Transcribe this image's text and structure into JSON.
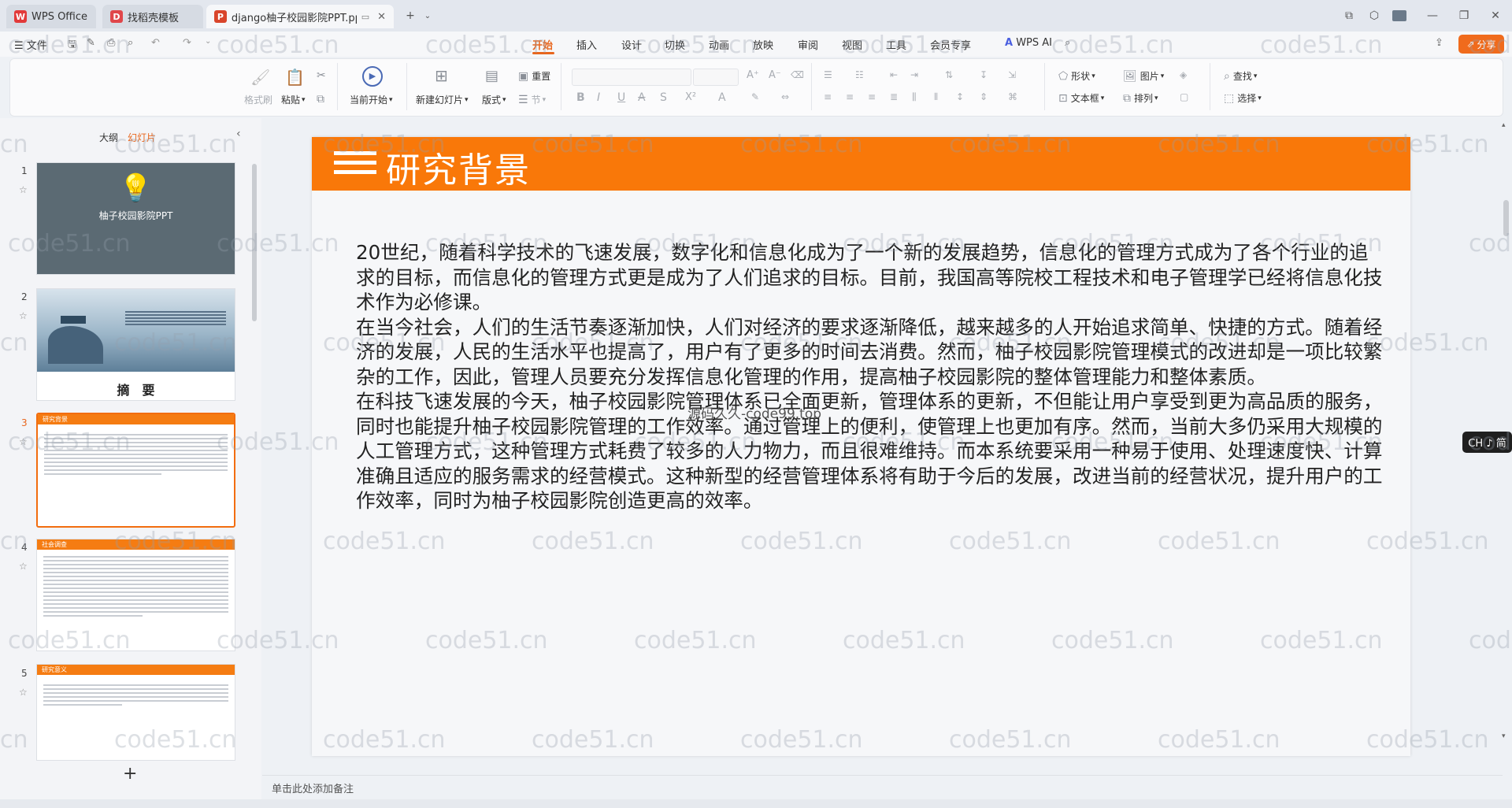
{
  "tabs": [
    {
      "label": "WPS Office",
      "icon": "wps-logo-icon"
    },
    {
      "label": "找稻壳模板",
      "icon": "docer-icon"
    },
    {
      "label": "django柚子校园影院PPT.pp",
      "icon": "ppt-file-icon"
    }
  ],
  "menu": {
    "file": "文件",
    "items": [
      "开始",
      "插入",
      "设计",
      "切换",
      "动画",
      "放映",
      "审阅",
      "视图",
      "工具",
      "会员专享"
    ],
    "active": "开始",
    "wps_ai": "WPS AI",
    "share": "分享"
  },
  "ribbon": {
    "format_painter": "格式刷",
    "paste": "粘贴",
    "play_from_start": "当前开始",
    "new_slide": "新建幻灯片",
    "layout": "版式",
    "reset": "重置",
    "section": "节",
    "shape": "形状",
    "picture": "图片",
    "textbox": "文本框",
    "arrange": "排列",
    "find": "查找",
    "select": "选择"
  },
  "leftpanel": {
    "outline_tab": "大纲",
    "slides_tab": "幻灯片",
    "thumbs": [
      {
        "num": "1",
        "title": "柚子校园影院PPT"
      },
      {
        "num": "2",
        "title": "摘　要"
      },
      {
        "num": "3",
        "title": "研究背景"
      },
      {
        "num": "4",
        "title": "社会调查"
      },
      {
        "num": "5",
        "title": "研究意义"
      }
    ],
    "add": "+"
  },
  "slide": {
    "title": "研究背景",
    "paragraphs": [
      "20世纪，随着科学技术的飞速发展，数字化和信息化成为了一个新的发展趋势，信息化的管理方式成为了各个行业的追求的目标，而信息化的管理方式更是成为了人们追求的目标。目前，我国高等院校工程技术和电子管理学已经将信息化技术作为必修课。",
      "在当今社会，人们的生活节奏逐渐加快，人们对经济的要求逐渐降低，越来越多的人开始追求简单、快捷的方式。随着经济的发展，人民的生活水平也提高了，用户有了更多的时间去消费。然而，柚子校园影院管理模式的改进却是一项比较繁杂的工作，因此，管理人员要充分发挥信息化管理的作用，提高柚子校园影院的整体管理能力和整体素质。",
      "在科技飞速发展的今天，柚子校园影院管理体系已全面更新，管理体系的更新，不但能让用户享受到更为高品质的服务，同时也能提升柚子校园影院管理的工作效率。通过管理上的便利，使管理上也更加有序。然而，当前大多仍采用大规模的人工管理方式，这种管理方式耗费了较多的人力物力，而且很难维持。而本系统要采用一种易于使用、处理速度快、计算准确且适应的服务需求的经营模式。这种新型的经营管理体系将有助于今后的发展，改进当前的经营状况，提升用户的工作效率，同时为柚子校园影院创造更高的效率。"
    ],
    "overlay_mark": "源码久久-code99.top"
  },
  "notes_placeholder": "单击此处添加备注",
  "ime": "CH ♪ 简",
  "watermark": "code51.cn"
}
